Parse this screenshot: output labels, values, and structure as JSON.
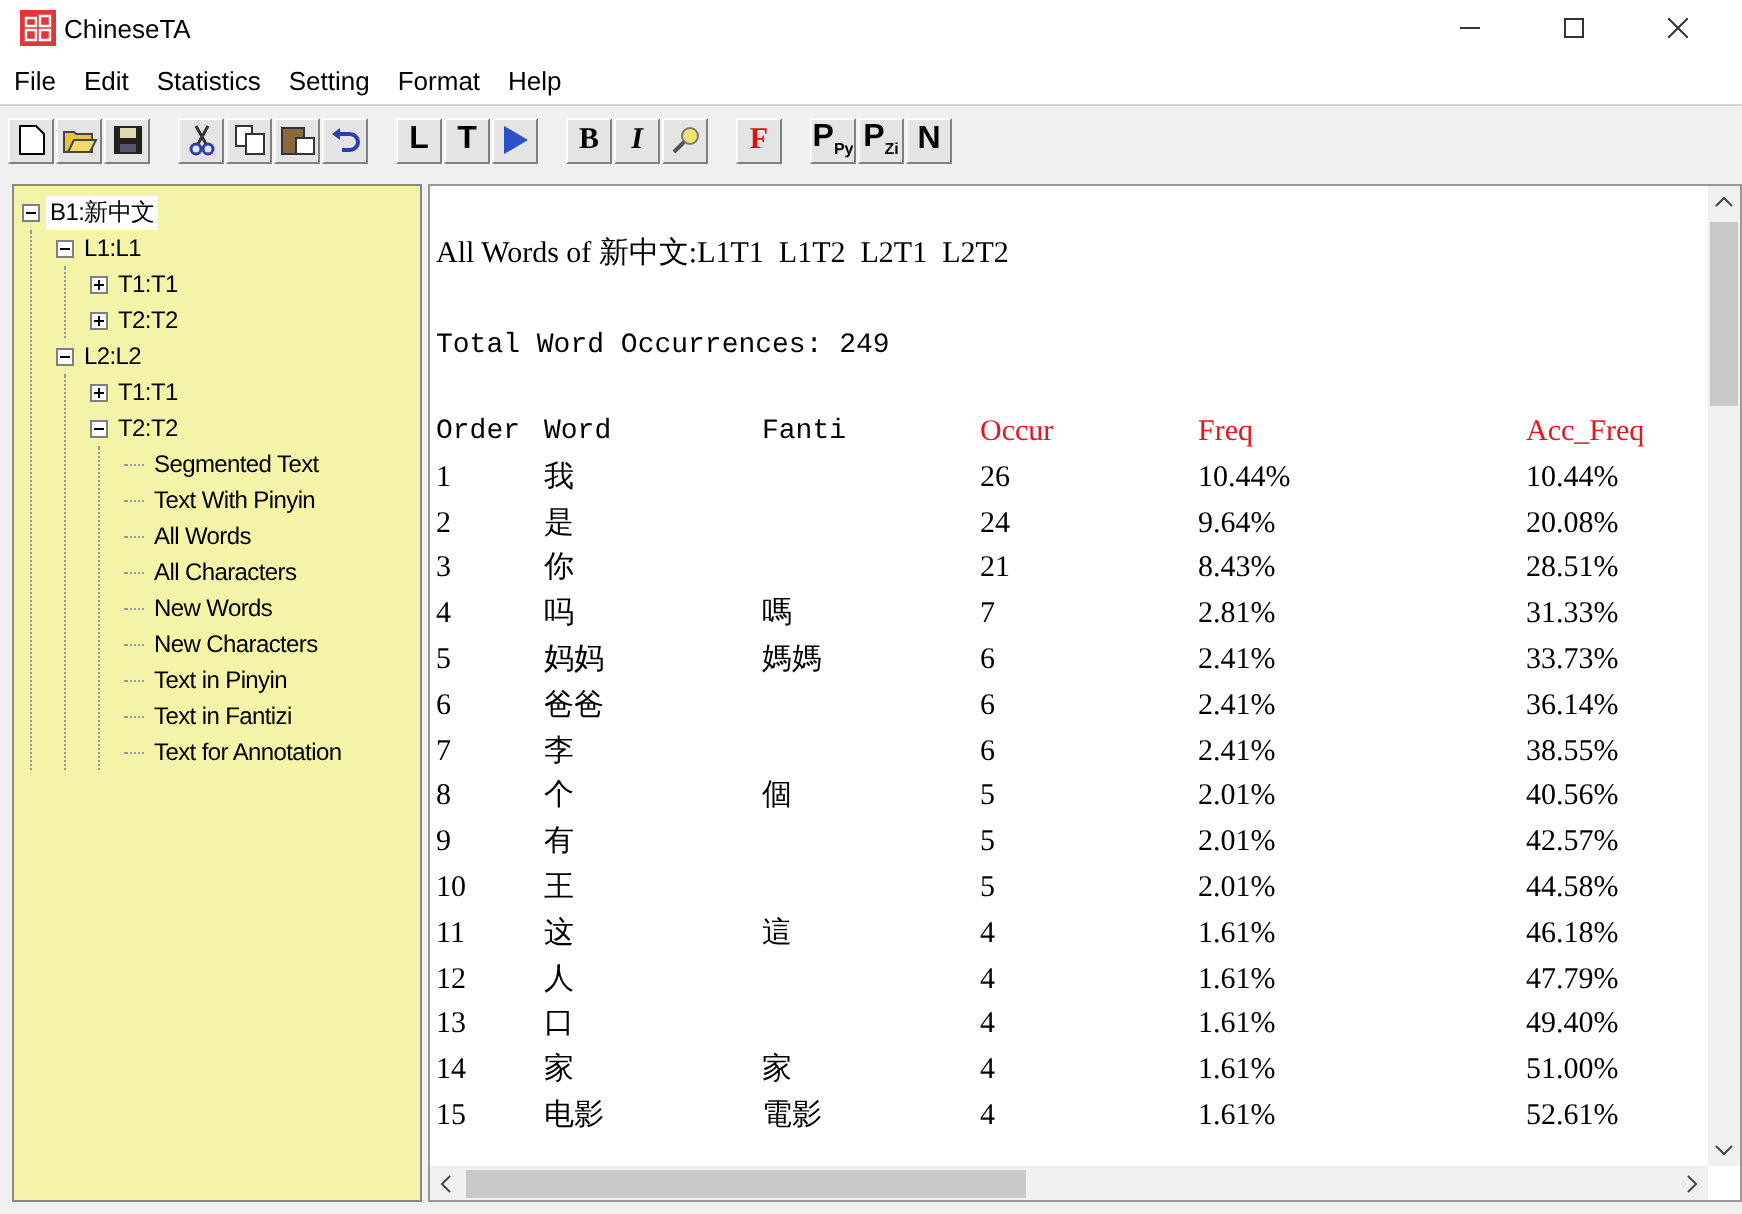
{
  "window": {
    "title": "ChineseTA"
  },
  "menu": [
    "File",
    "Edit",
    "Statistics",
    "Setting",
    "Format",
    "Help"
  ],
  "toolbar": {
    "text_buttons": [
      {
        "label": "L",
        "kind": "sans"
      },
      {
        "label": "T",
        "kind": "sans"
      },
      {
        "label": "B",
        "kind": "bold"
      },
      {
        "label": "I",
        "kind": "italic"
      },
      {
        "label": "F",
        "kind": "red"
      },
      {
        "label": "P$_{Py}$",
        "kind": "sans"
      },
      {
        "label": "P$_{Zi}$",
        "kind": "sans"
      },
      {
        "label": "N",
        "kind": "sans"
      }
    ]
  },
  "tree": [
    {
      "label": "B1:新中文",
      "selected": true,
      "expanded": true,
      "children": [
        {
          "label": "L1:L1",
          "selected": false,
          "expanded": true,
          "children": [
            {
              "label": "T1:T1",
              "selected": false,
              "expanded": false
            },
            {
              "label": "T2:T2",
              "selected": false,
              "expanded": false
            }
          ]
        },
        {
          "label": "L2:L2",
          "selected": false,
          "expanded": true,
          "children": [
            {
              "label": "T1:T1",
              "selected": false,
              "expanded": false
            },
            {
              "label": "T2:T2",
              "selected": false,
              "expanded": true,
              "children": [
                {
                  "label": "Segmented Text",
                  "selected": false
                },
                {
                  "label": "Text With Pinyin",
                  "selected": false
                },
                {
                  "label": "All Words",
                  "selected": false
                },
                {
                  "label": "All Characters",
                  "selected": false
                },
                {
                  "label": "New Words",
                  "selected": false
                },
                {
                  "label": "New Characters",
                  "selected": false
                },
                {
                  "label": "Text in Pinyin",
                  "selected": false
                },
                {
                  "label": "Text in Fantizi",
                  "selected": false
                },
                {
                  "label": "Text for Annotation",
                  "selected": false
                }
              ]
            }
          ]
        }
      ]
    }
  ],
  "report": {
    "heading": "All Words of 新中文:L1T1  L1T2  L2T1  L2T2",
    "total": "Total Word Occurrences: 249",
    "table": {
      "columns": [
        {
          "label": "Order",
          "color": "#000000"
        },
        {
          "label": "Word",
          "color": "#000000"
        },
        {
          "label": "Fanti",
          "color": "#000000"
        },
        {
          "label": "Occur",
          "color": "#e8141e"
        },
        {
          "label": "Freq",
          "color": "#e8141e"
        },
        {
          "label": "Acc_Freq",
          "color": "#e8141e"
        }
      ],
      "rows": [
        [
          "1",
          "我",
          "",
          "26",
          "10.44%",
          "10.44%"
        ],
        [
          "2",
          "是",
          "",
          "24",
          "9.64%",
          "20.08%"
        ],
        [
          "3",
          "你",
          "",
          "21",
          "8.43%",
          "28.51%"
        ],
        [
          "4",
          "吗",
          "嗎",
          "7",
          "2.81%",
          "31.33%"
        ],
        [
          "5",
          "妈妈",
          "媽媽",
          "6",
          "2.41%",
          "33.73%"
        ],
        [
          "6",
          "爸爸",
          "",
          "6",
          "2.41%",
          "36.14%"
        ],
        [
          "7",
          "李",
          "",
          "6",
          "2.41%",
          "38.55%"
        ],
        [
          "8",
          "个",
          "個",
          "5",
          "2.01%",
          "40.56%"
        ],
        [
          "9",
          "有",
          "",
          "5",
          "2.01%",
          "42.57%"
        ],
        [
          "10",
          "王",
          "",
          "5",
          "2.01%",
          "44.58%"
        ],
        [
          "11",
          "这",
          "這",
          "4",
          "1.61%",
          "46.18%"
        ],
        [
          "12",
          "人",
          "",
          "4",
          "1.61%",
          "47.79%"
        ],
        [
          "13",
          "口",
          "",
          "4",
          "1.61%",
          "49.40%"
        ],
        [
          "14",
          "家",
          "家",
          "4",
          "1.61%",
          "51.00%"
        ],
        [
          "15",
          "电影",
          "電影",
          "4",
          "1.61%",
          "52.61%"
        ]
      ]
    }
  }
}
